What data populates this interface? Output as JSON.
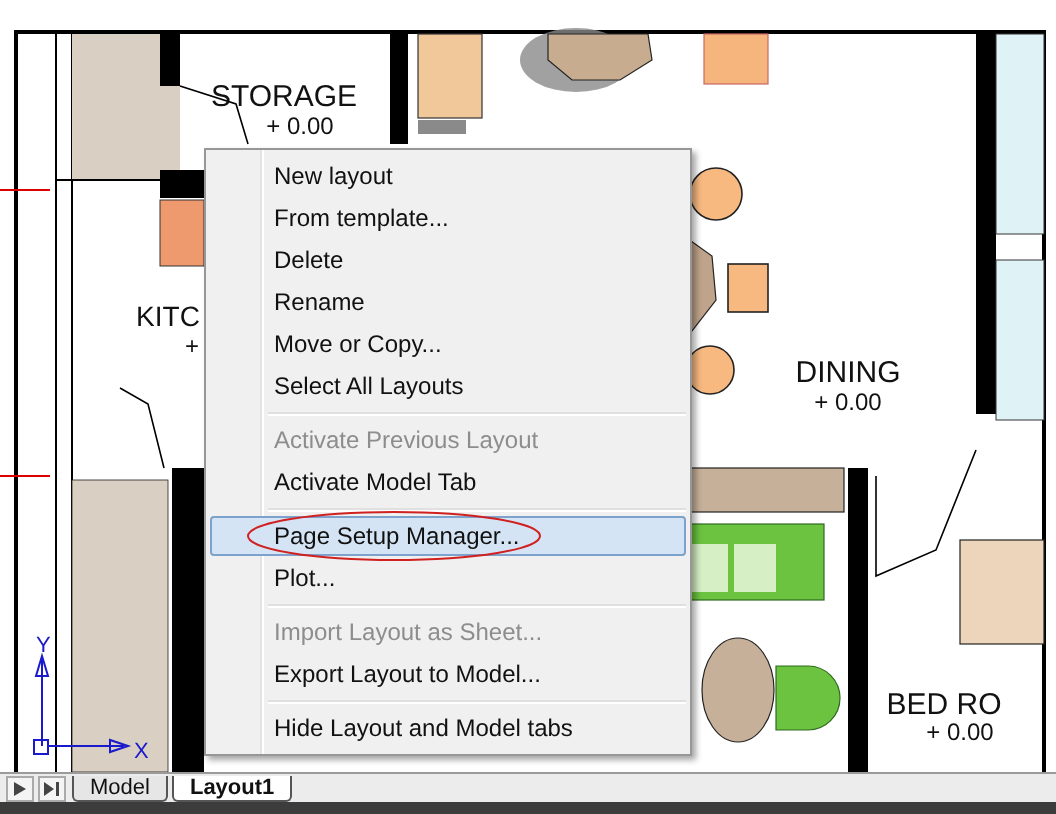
{
  "drawing": {
    "room_labels": [
      {
        "name": "STORAGE",
        "elevation": "+ 0.00"
      },
      {
        "name": "KITC",
        "elevation": "+"
      },
      {
        "name": "DINING",
        "elevation": "+ 0.00"
      },
      {
        "name": "BED RO",
        "elevation": "+ 0.00"
      }
    ],
    "ucs_axes": [
      "X",
      "Y"
    ]
  },
  "context_menu": {
    "items": [
      {
        "kind": "item",
        "label": "New layout",
        "disabled": false,
        "selected": false
      },
      {
        "kind": "item",
        "label": "From template...",
        "disabled": false,
        "selected": false
      },
      {
        "kind": "item",
        "label": "Delete",
        "disabled": false,
        "selected": false
      },
      {
        "kind": "item",
        "label": "Rename",
        "disabled": false,
        "selected": false
      },
      {
        "kind": "item",
        "label": "Move or Copy...",
        "disabled": false,
        "selected": false
      },
      {
        "kind": "item",
        "label": "Select All Layouts",
        "disabled": false,
        "selected": false
      },
      {
        "kind": "separator"
      },
      {
        "kind": "item",
        "label": "Activate Previous Layout",
        "disabled": true,
        "selected": false
      },
      {
        "kind": "item",
        "label": "Activate Model Tab",
        "disabled": false,
        "selected": false
      },
      {
        "kind": "separator"
      },
      {
        "kind": "item",
        "label": "Page Setup Manager...",
        "disabled": false,
        "selected": true,
        "circled": true
      },
      {
        "kind": "item",
        "label": "Plot...",
        "disabled": false,
        "selected": false
      },
      {
        "kind": "separator"
      },
      {
        "kind": "item",
        "label": "Import Layout as Sheet...",
        "disabled": true,
        "selected": false
      },
      {
        "kind": "item",
        "label": "Export Layout to Model...",
        "disabled": false,
        "selected": false
      },
      {
        "kind": "separator"
      },
      {
        "kind": "item",
        "label": "Hide Layout and Model tabs",
        "disabled": false,
        "selected": false
      }
    ]
  },
  "layout_tabs": [
    {
      "label": "Model",
      "selected": false
    },
    {
      "label": "Layout1",
      "selected": true
    }
  ]
}
